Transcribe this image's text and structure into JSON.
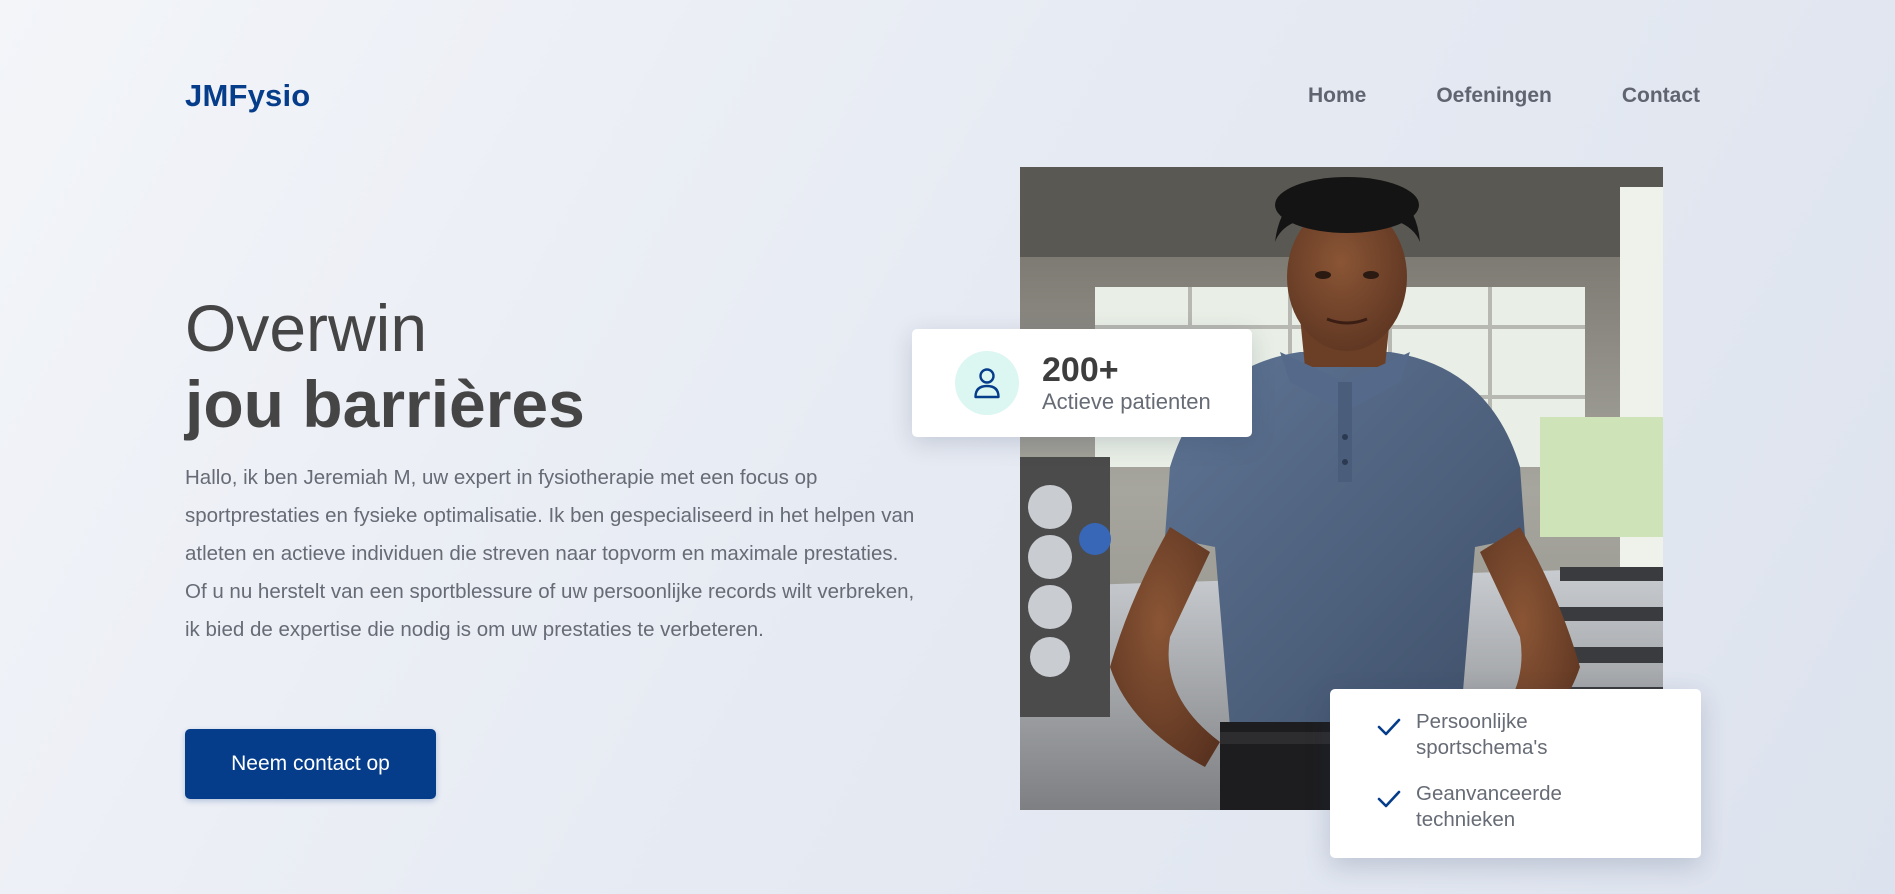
{
  "header": {
    "logo": "JMFysio",
    "nav": [
      {
        "label": "Home"
      },
      {
        "label": "Oefeningen"
      },
      {
        "label": "Contact"
      }
    ]
  },
  "hero": {
    "title_line1": "Overwin",
    "title_line2": "jou barrières",
    "paragraph": "Hallo, ik ben Jeremiah M, uw expert in fysiotherapie met een focus op sportprestaties en fysieke optimalisatie. Ik ben gespecialiseerd in het helpen van atleten en actieve individuen die streven naar topvorm en maximale prestaties. Of u nu herstelt van een sportblessure of uw persoonlijke records wilt verbreken, ik bied de expertise die nodig is om uw prestaties te verbeteren.",
    "cta_label": "Neem contact op"
  },
  "stat_card": {
    "icon": "user-icon",
    "number": "200+",
    "label": "Actieve patienten"
  },
  "features_card": {
    "items": [
      {
        "icon": "check-icon",
        "text": "Persoonlijke sportschema's"
      },
      {
        "icon": "check-icon",
        "text": "Geanvanceerde technieken"
      }
    ]
  },
  "colors": {
    "brand": "#063d8a",
    "text_dark": "#454545",
    "text_muted": "#666b75",
    "icon_bg": "#dcf6f1"
  }
}
